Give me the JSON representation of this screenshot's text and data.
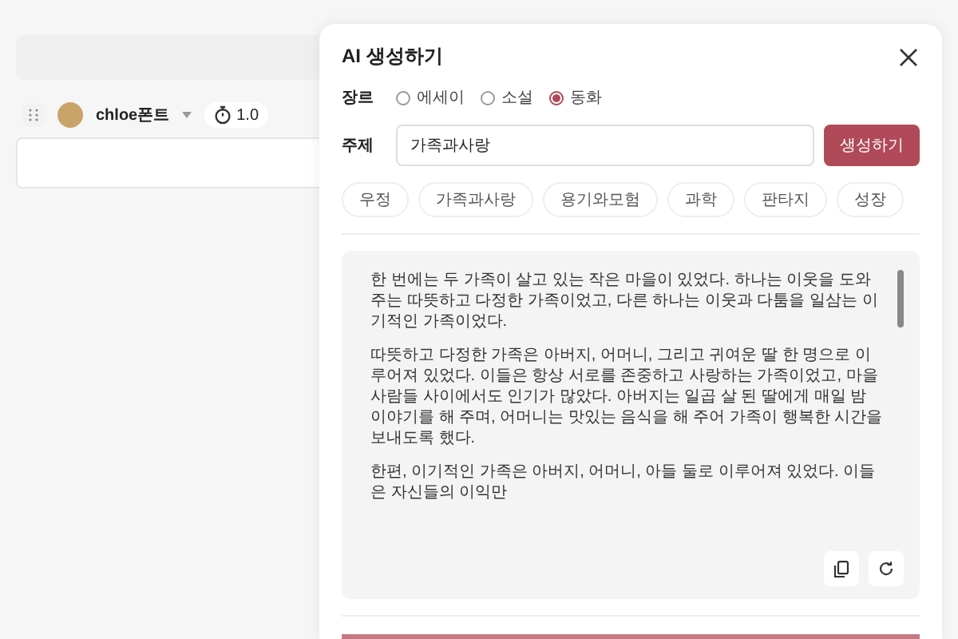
{
  "background": {
    "author": {
      "name": "chloe폰트"
    },
    "timer": {
      "value": "1.0"
    }
  },
  "dialog": {
    "title": "AI 생성하기",
    "genre": {
      "label": "장르",
      "options": [
        {
          "label": "에세이",
          "selected": false
        },
        {
          "label": "소설",
          "selected": false
        },
        {
          "label": "동화",
          "selected": true
        }
      ]
    },
    "topic": {
      "label": "주제",
      "value": "가족과사랑"
    },
    "generate_button": "생성하기",
    "suggestions": [
      "우정",
      "가족과사랑",
      "용기와모험",
      "과학",
      "판타지",
      "성장"
    ],
    "result": {
      "paragraphs": [
        "한 번에는 두 가족이 살고 있는 작은 마을이 있었다. 하나는 이웃을 도와주는 따뜻하고 다정한 가족이었고, 다른 하나는 이웃과 다툼을 일삼는 이기적인 가족이었다.",
        "따뜻하고 다정한 가족은 아버지, 어머니, 그리고 귀여운 딸 한 명으로 이루어져 있었다. 이들은 항상 서로를 존중하고 사랑하는 가족이었고, 마을 사람들 사이에서도 인기가 많았다. 아버지는 일곱 살 된 딸에게 매일 밤 이야기를 해 주며, 어머니는 맛있는 음식을 해 주어 가족이 행복한 시간을 보내도록 했다.",
        "한편, 이기적인 가족은 아버지, 어머니, 아들 둘로 이루어져 있었다. 이들은 자신들의 이익만"
      ]
    }
  }
}
